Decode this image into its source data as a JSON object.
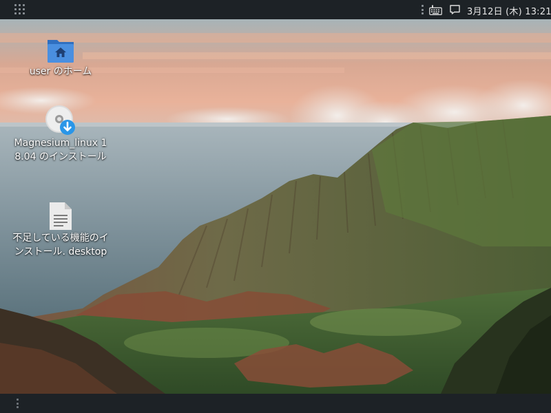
{
  "top_panel": {
    "clock_text": "3月12日 (木) 13:21",
    "icons": [
      "apps-grid-icon",
      "keyboard-icon",
      "message-icon"
    ]
  },
  "desktop": {
    "icons": [
      {
        "label": "user のホーム",
        "icon": "home-folder-icon"
      },
      {
        "label": "Magnesium_linux 18.04 のインストール",
        "icon": "installer-disc-icon"
      },
      {
        "label": "不足している機能のインストール. desktop",
        "icon": "text-file-icon"
      }
    ]
  },
  "colors": {
    "panel": "#1d2226",
    "folder_blue": "#4a8fe0",
    "download_badge": "#2a96e8"
  }
}
